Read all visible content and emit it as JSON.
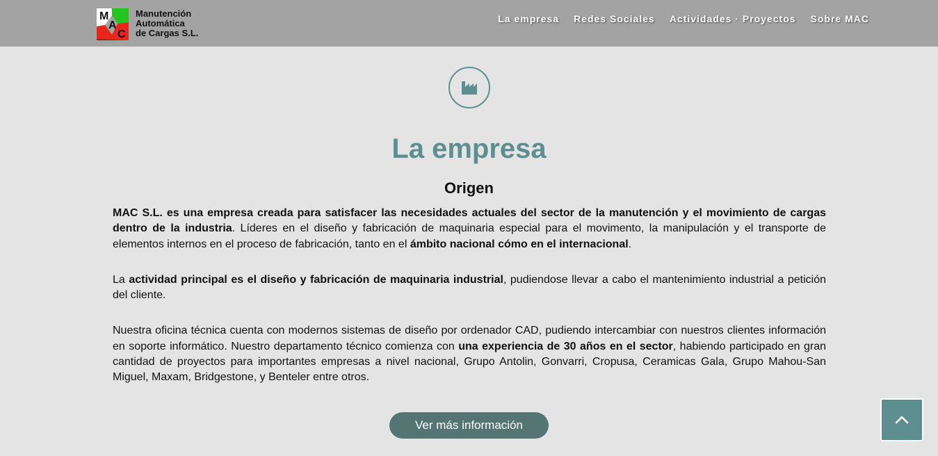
{
  "header": {
    "logo": {
      "letters": [
        "M",
        "A",
        "C"
      ],
      "lines": [
        "Manutención",
        "Automática",
        "de Cargas S.L."
      ]
    },
    "nav": [
      {
        "label": "La empresa"
      },
      {
        "label": "Redes Sociales"
      },
      {
        "label": "Actividades · Proyectos"
      },
      {
        "label": "Sobre MAC"
      }
    ]
  },
  "section": {
    "icon": "factory-icon",
    "title": "La empresa",
    "subtitle": "Origen",
    "paragraphs": [
      [
        {
          "text": "MAC S.L. es una empresa creada para satisfacer las necesidades actuales del sector de la manutención y el movimiento de cargas dentro de la industria",
          "bold": true
        },
        {
          "text": ". Líderes en el diseño y fabricación de maquinaria especial para el movimento, la manipulación y el transporte de elementos internos en el proceso de fabricación, tanto en el ",
          "bold": false
        },
        {
          "text": "ámbito nacional cómo en el internacional",
          "bold": true
        },
        {
          "text": ".",
          "bold": false
        }
      ],
      [
        {
          "text": "La ",
          "bold": false
        },
        {
          "text": "actividad principal es el diseño y fabricación de maquinaria industrial",
          "bold": true
        },
        {
          "text": ", pudiendose llevar a cabo el mantenimiento industrial a petición del cliente.",
          "bold": false
        }
      ],
      [
        {
          "text": "Nuestra oficina técnica cuenta con modernos sistemas de diseño por ordenador CAD, pudiendo intercambiar con nuestros clientes información en soporte informático. Nuestro departamento técnico comienza con ",
          "bold": false
        },
        {
          "text": "una experiencia de 30 años en el sector",
          "bold": true
        },
        {
          "text": ", habiendo participado en gran cantidad de proyectos para importantes empresas a nivel nacional, Grupo Antolin, Gonvarri, Cropusa, Ceramicas Gala, Grupo Mahou-San Miguel, Maxam, Bridgestone, y Benteler entre otros.",
          "bold": false
        }
      ]
    ],
    "button": {
      "label": "Ver más información"
    }
  },
  "scroll_top": {
    "icon": "chevron-up-icon"
  },
  "colors": {
    "header_bg": "#a3a3a3",
    "page_bg": "#e4e4e4",
    "accent": "#5e8f90",
    "button_bg": "#557474",
    "logo_red": "#e8261c",
    "logo_green": "#26c41e"
  }
}
